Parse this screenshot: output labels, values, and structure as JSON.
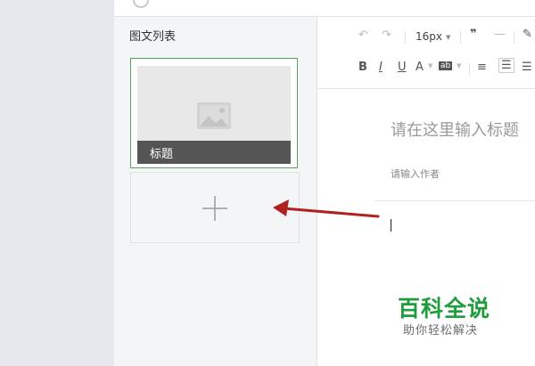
{
  "sidebar": {
    "section_title": "图文列表",
    "article_card": {
      "title": "标题",
      "cover_icon": "image-icon"
    },
    "add_button_icon": "plus-icon"
  },
  "toolbar": {
    "font_size": "16px",
    "icons": [
      "undo-icon",
      "redo-icon",
      "quote-icon",
      "divider-icon",
      "brush-icon",
      "bold-icon",
      "italic-icon",
      "underline-icon",
      "font-color-icon",
      "background-color-icon",
      "indent-icon",
      "align-left-icon",
      "align-center-icon"
    ],
    "glyphs": {
      "bold": "B",
      "italic": "I",
      "underline": "U",
      "font_color": "A",
      "bg_color": "ab"
    }
  },
  "editor": {
    "title_placeholder": "请在这里输入标题",
    "author_placeholder": "请输入作者"
  },
  "watermark": {
    "brand": "百科全说",
    "slogan": "助你轻松解决"
  },
  "colors": {
    "accent_green": "#52a55a",
    "arrow_red": "#b0221f",
    "watermark_green": "#1f9c3c"
  }
}
